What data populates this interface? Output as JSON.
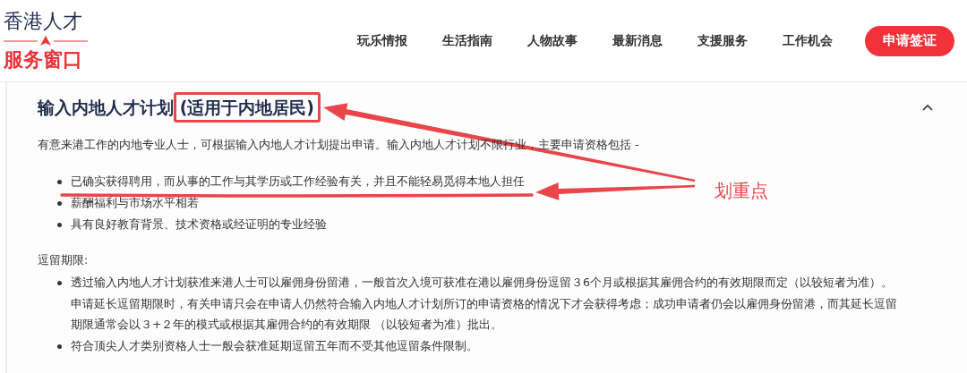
{
  "logo": {
    "top": "香港人才",
    "bottom": "服务窗口"
  },
  "nav": {
    "items": [
      {
        "label": "玩乐情报",
        "selected": false
      },
      {
        "label": "生活指南",
        "selected": false
      },
      {
        "label": "人物故事",
        "selected": false
      },
      {
        "label": "最新消息",
        "selected": false
      },
      {
        "label": "支援服务",
        "selected": false
      },
      {
        "label": "工作机会",
        "selected": false
      }
    ],
    "cta": "申请签证"
  },
  "section": {
    "title": "输入内地人才计划",
    "title_note": "(适用于内地居民)",
    "title_note_boxed": true,
    "expanded": true,
    "intro": "有意来港工作的内地专业人士，可根据输入内地人才计划提出申请。输入内地人才计划不限行业，主要申请资格包括 -",
    "requirements": [
      {
        "text": "已确实获得聘用，而从事的工作与其学历或工作经验有关，并且不能轻易觅得本地人担任",
        "underlined": true
      },
      {
        "text": "薪酬福利与市场水平相若",
        "underlined": false
      },
      {
        "text": "具有良好教育背景、技术资格或经证明的专业经验",
        "underlined": false
      }
    ],
    "stay_heading": "逗留期限:",
    "stay_items": [
      {
        "text": "透过输入内地人才计划获准来港人士可以雇佣身份留港，一般首次入境可获准在港以雇佣身份逗留３6个月或根据其雇佣合约的有效期限而定（以较短者为准）。申请延长逗留期限时，有关申请只会在申请人仍然符合输入内地人才计划所订的申请资格的情况下才会获得考虑；成功申请者仍会以雇佣身份留港，而其延长逗留期限通常会以３+２年的模式或根据其雇佣合约的有效期限 （以较短者为准）批出。"
      },
      {
        "text": "符合顶尖人才类别资格人士一般会获准延期逗留五年而不受其他逗留条件限制。"
      }
    ]
  },
  "annotation": {
    "label": "划重点"
  }
}
